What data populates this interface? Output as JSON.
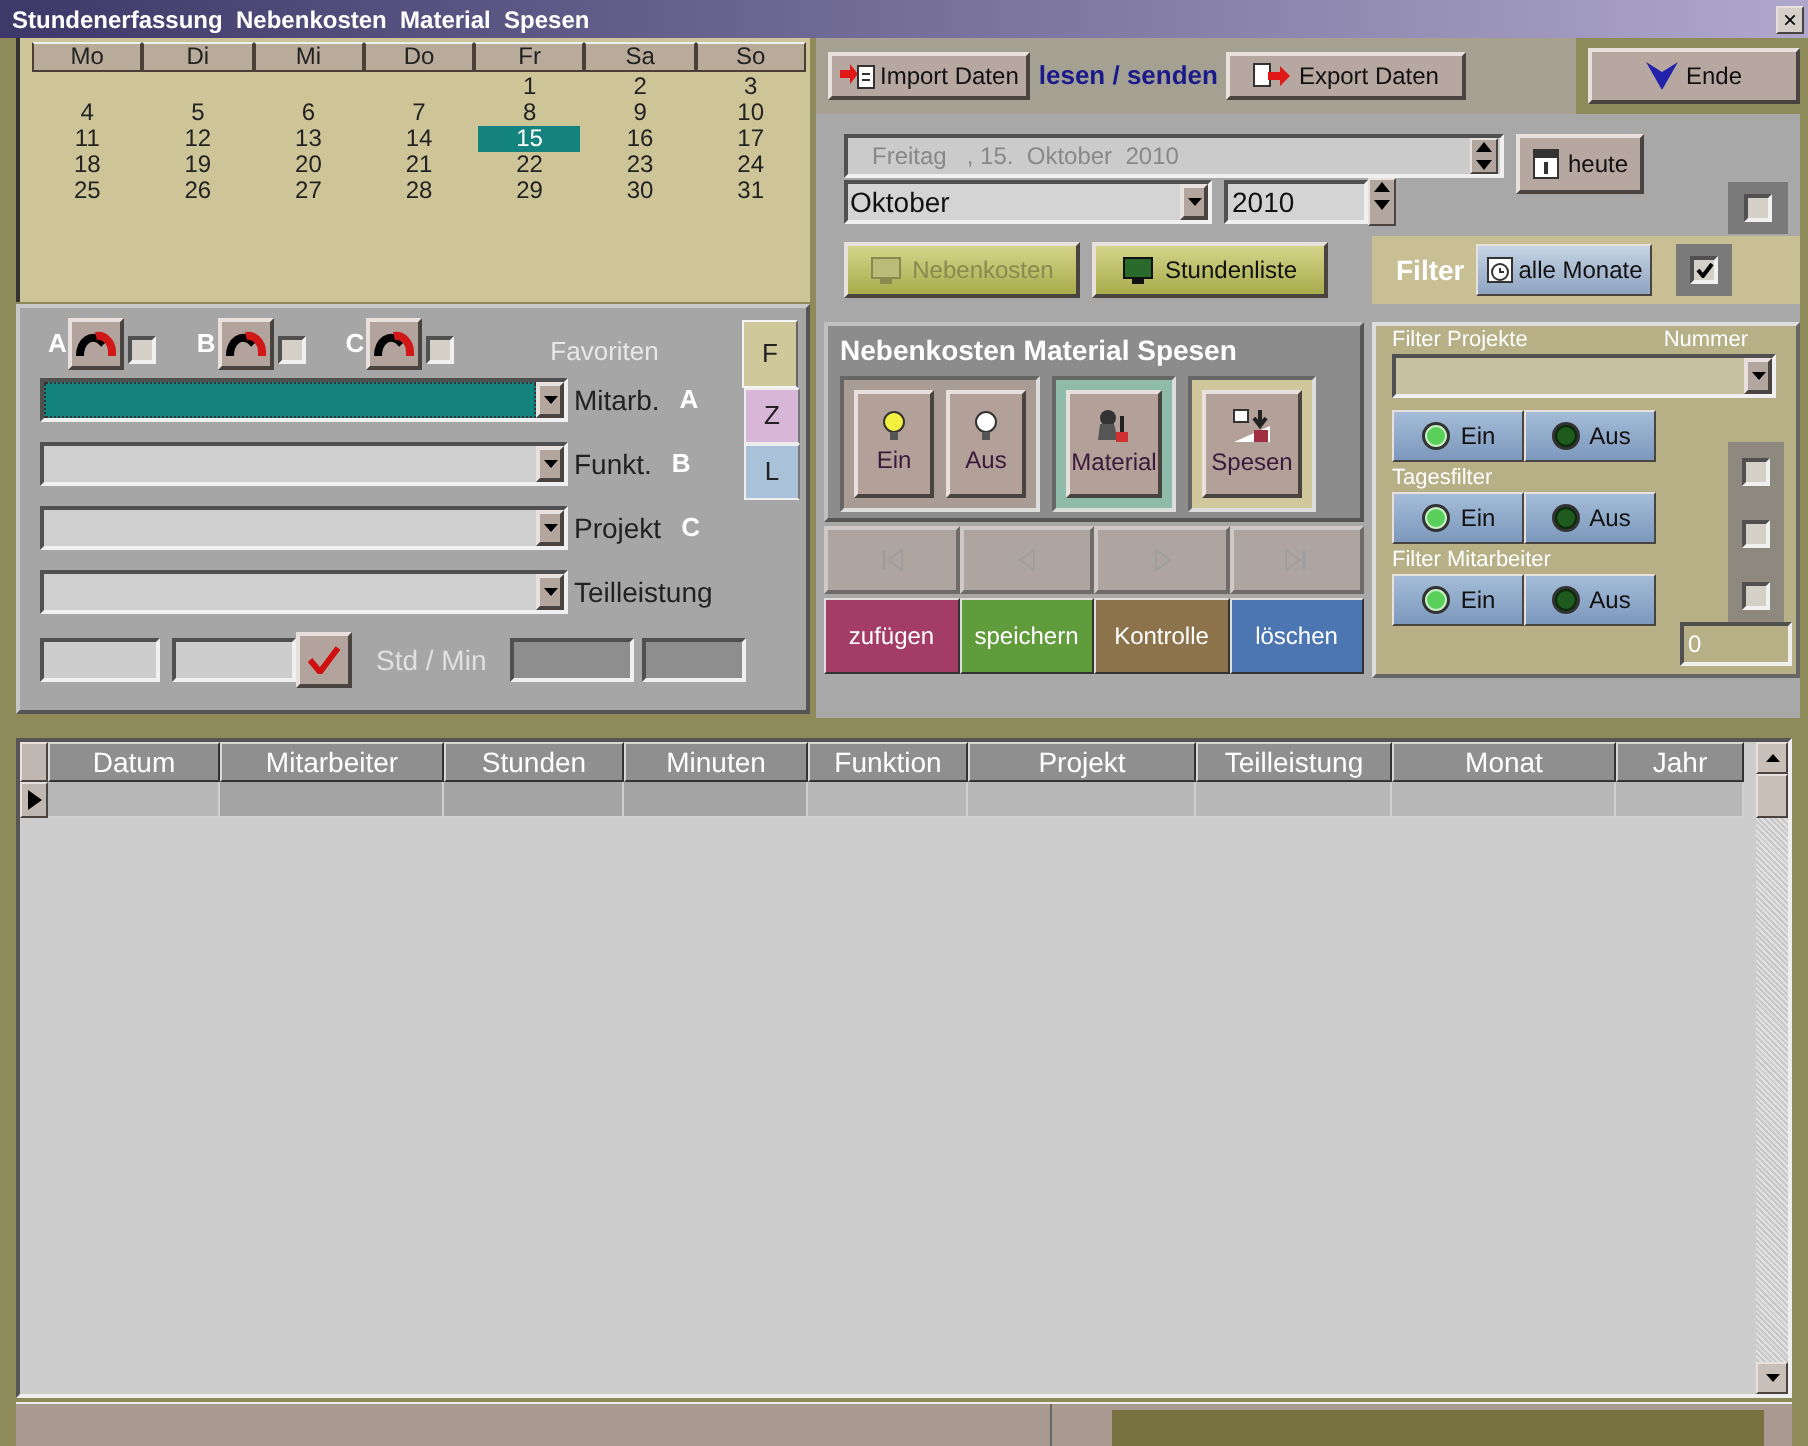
{
  "window": {
    "title": "Stundenerfassung  Nebenkosten  Material  Spesen",
    "close": "×"
  },
  "calendar": {
    "weekdays": [
      "Mo",
      "Di",
      "Mi",
      "Do",
      "Fr",
      "Sa",
      "So"
    ],
    "weeks": [
      [
        {
          "day": "1",
          "selected": false
        },
        {
          "day": "2",
          "selected": false
        },
        {
          "day": "3",
          "selected": false
        }
      ],
      [
        {
          "day": "4",
          "selected": false
        },
        {
          "day": "5",
          "selected": false
        },
        {
          "day": "6",
          "selected": false
        },
        {
          "day": "7",
          "selected": false
        },
        {
          "day": "8",
          "selected": false
        },
        {
          "day": "9",
          "selected": false
        },
        {
          "day": "10",
          "selected": false
        }
      ],
      [
        {
          "day": "11",
          "selected": false
        },
        {
          "day": "12",
          "selected": false
        },
        {
          "day": "13",
          "selected": false
        },
        {
          "day": "14",
          "selected": false
        },
        {
          "day": "15",
          "selected": true
        },
        {
          "day": "16",
          "selected": false
        },
        {
          "day": "17",
          "selected": false
        }
      ],
      [
        {
          "day": "18",
          "selected": false
        },
        {
          "day": "19",
          "selected": false
        },
        {
          "day": "20",
          "selected": false
        },
        {
          "day": "21",
          "selected": false
        },
        {
          "day": "22",
          "selected": false
        },
        {
          "day": "23",
          "selected": false
        },
        {
          "day": "24",
          "selected": false
        }
      ],
      [
        {
          "day": "25",
          "selected": false
        },
        {
          "day": "26",
          "selected": false
        },
        {
          "day": "27",
          "selected": false
        },
        {
          "day": "28",
          "selected": false
        },
        {
          "day": "29",
          "selected": false
        },
        {
          "day": "30",
          "selected": false
        },
        {
          "day": "31",
          "selected": false
        }
      ]
    ]
  },
  "favorites_slots": [
    {
      "letter": "A",
      "checked": false
    },
    {
      "letter": "B",
      "checked": false
    },
    {
      "letter": "C",
      "checked": false
    }
  ],
  "favorites_label": "Favoriten",
  "favorite_tabs": [
    {
      "label": "F",
      "selected": true,
      "color": "#cfc89a"
    },
    {
      "label": "Z",
      "selected": false,
      "color": "#d8b6d8"
    },
    {
      "label": "L",
      "selected": false,
      "color": "#a9c1d9"
    }
  ],
  "selectors": [
    {
      "label": "Mitarb.",
      "letter": "A",
      "focused": true
    },
    {
      "label": "Funkt.",
      "letter": "B",
      "focused": false
    },
    {
      "label": "Projekt",
      "letter": "C",
      "focused": false
    },
    {
      "label": "Teilleistung",
      "focused": false
    }
  ],
  "time_label": "Std / Min",
  "toolbar": {
    "import": "Import Daten",
    "sync_label": "lesen / senden",
    "export": "Export Daten",
    "quit": "Ende"
  },
  "date_field": {
    "value": "Freitag   , 15.  Oktober  2010"
  },
  "today_button": "heute",
  "month_select": {
    "value": "Oktober"
  },
  "year_field": {
    "value": "2010"
  },
  "top_checkbox": {
    "checked": false
  },
  "list_buttons": [
    {
      "label": "Nebenkosten",
      "disabled": true
    },
    {
      "label": "Stundenliste",
      "disabled": false
    }
  ],
  "filter": {
    "label": "Filter",
    "button": "alle Monate",
    "checked": true
  },
  "expenses": {
    "title": "Nebenkosten Material Spesen",
    "buttons": [
      {
        "kind": "bulb",
        "label": "Ein",
        "lit": true
      },
      {
        "kind": "bulb",
        "label": "Aus",
        "lit": false
      },
      {
        "kind": "material",
        "label": "Material"
      },
      {
        "kind": "expenses",
        "label": "Spesen"
      }
    ]
  },
  "navigation": [
    {
      "kind": "first",
      "disabled": true
    },
    {
      "kind": "prev",
      "disabled": true
    },
    {
      "kind": "next",
      "disabled": true
    },
    {
      "kind": "last",
      "disabled": true
    }
  ],
  "actions": [
    {
      "label": "zufügen",
      "color": "#a33d66"
    },
    {
      "label": "speichern",
      "color": "#619c3c"
    },
    {
      "label": "Kontrolle",
      "color": "#8c734b"
    },
    {
      "label": "löschen",
      "color": "#4b76b2"
    }
  ],
  "filter_panel": {
    "projects_label": "Filter Projekte",
    "number_label": "Nummer",
    "groups": [
      {
        "buttons": [
          {
            "label": "Ein",
            "lit": true
          },
          {
            "label": "Aus",
            "lit": false
          }
        ]
      },
      {
        "label": "Tagesfilter",
        "buttons": [
          {
            "label": "Ein",
            "lit": true
          },
          {
            "label": "Aus",
            "lit": false
          }
        ]
      },
      {
        "label": "Filter Mitarbeiter",
        "buttons": [
          {
            "label": "Ein",
            "lit": true
          },
          {
            "label": "Aus",
            "lit": false
          }
        ]
      }
    ],
    "checkboxes": [
      {
        "checked": false
      },
      {
        "checked": false
      },
      {
        "checked": false
      }
    ],
    "count": "0"
  },
  "status_bar": {
    "level": 0.96
  },
  "table": {
    "columns": [
      "Datum",
      "Mitarbeiter",
      "Stunden",
      "Minuten",
      "Funktion",
      "Projekt",
      "Teilleistung",
      "Monat",
      "Jahr"
    ],
    "rows": [
      {
        "selected": true
      }
    ]
  }
}
